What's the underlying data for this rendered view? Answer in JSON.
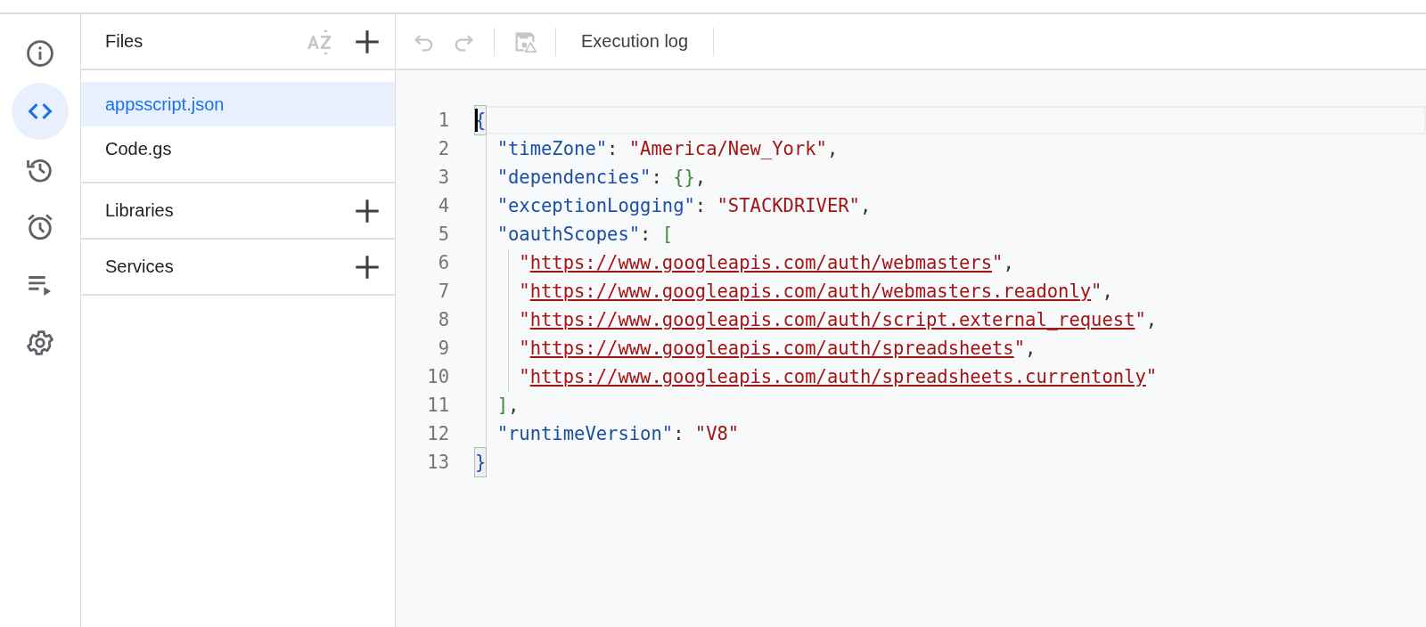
{
  "rail": [
    {
      "kind": "info",
      "selected": false
    },
    {
      "kind": "code",
      "selected": true
    },
    {
      "kind": "history",
      "selected": false
    },
    {
      "kind": "triggers",
      "selected": false
    },
    {
      "kind": "executions",
      "selected": false
    },
    {
      "kind": "settings",
      "selected": false
    }
  ],
  "files": {
    "title": "Files",
    "items": [
      {
        "name": "appsscript.json",
        "selected": true
      },
      {
        "name": "Code.gs",
        "selected": false
      }
    ]
  },
  "sections": [
    {
      "title": "Libraries"
    },
    {
      "title": "Services"
    }
  ],
  "toolbar": {
    "buttons": [
      {
        "kind": "undo",
        "disabled": true
      },
      {
        "kind": "redo",
        "disabled": true
      },
      {
        "kind": "save",
        "disabled": true
      }
    ],
    "execution_log": "Execution log"
  },
  "editor": {
    "lines": [
      {
        "number": "1",
        "current": true,
        "tokens": [
          {
            "kind": "brace",
            "text": "{",
            "matched": true
          }
        ]
      },
      {
        "number": "2",
        "current": false,
        "tokens": [
          {
            "kind": "key",
            "text": "  \"timeZone\""
          },
          {
            "kind": "punct",
            "text": ": "
          },
          {
            "kind": "string",
            "text": "\"America/New_York\""
          },
          {
            "kind": "punct",
            "text": ","
          }
        ]
      },
      {
        "number": "3",
        "current": false,
        "tokens": [
          {
            "kind": "key",
            "text": "  \"dependencies\""
          },
          {
            "kind": "punct",
            "text": ": "
          },
          {
            "kind": "bracket",
            "text": "{}"
          },
          {
            "kind": "punct",
            "text": ","
          }
        ]
      },
      {
        "number": "4",
        "current": false,
        "tokens": [
          {
            "kind": "key",
            "text": "  \"exceptionLogging\""
          },
          {
            "kind": "punct",
            "text": ": "
          },
          {
            "kind": "string",
            "text": "\"STACKDRIVER\""
          },
          {
            "kind": "punct",
            "text": ","
          }
        ]
      },
      {
        "number": "5",
        "current": false,
        "tokens": [
          {
            "kind": "key",
            "text": "  \"oauthScopes\""
          },
          {
            "kind": "punct",
            "text": ": "
          },
          {
            "kind": "bracket",
            "text": "["
          }
        ]
      },
      {
        "number": "6",
        "current": false,
        "tokens": [
          {
            "kind": "string",
            "text": "    \""
          },
          {
            "kind": "url",
            "text": "https://www.googleapis.com/auth/webmasters"
          },
          {
            "kind": "string",
            "text": "\""
          },
          {
            "kind": "punct",
            "text": ","
          }
        ]
      },
      {
        "number": "7",
        "current": false,
        "tokens": [
          {
            "kind": "string",
            "text": "    \""
          },
          {
            "kind": "url",
            "text": "https://www.googleapis.com/auth/webmasters.readonly"
          },
          {
            "kind": "string",
            "text": "\""
          },
          {
            "kind": "punct",
            "text": ","
          }
        ]
      },
      {
        "number": "8",
        "current": false,
        "tokens": [
          {
            "kind": "string",
            "text": "    \""
          },
          {
            "kind": "url",
            "text": "https://www.googleapis.com/auth/script.external_request"
          },
          {
            "kind": "string",
            "text": "\""
          },
          {
            "kind": "punct",
            "text": ","
          }
        ]
      },
      {
        "number": "9",
        "current": false,
        "tokens": [
          {
            "kind": "string",
            "text": "    \""
          },
          {
            "kind": "url",
            "text": "https://www.googleapis.com/auth/spreadsheets"
          },
          {
            "kind": "string",
            "text": "\""
          },
          {
            "kind": "punct",
            "text": ","
          }
        ]
      },
      {
        "number": "10",
        "current": false,
        "tokens": [
          {
            "kind": "string",
            "text": "    \""
          },
          {
            "kind": "url",
            "text": "https://www.googleapis.com/auth/spreadsheets.currentonly"
          },
          {
            "kind": "string",
            "text": "\""
          }
        ]
      },
      {
        "number": "11",
        "current": false,
        "tokens": [
          {
            "kind": "bracket",
            "text": "  ]"
          },
          {
            "kind": "punct",
            "text": ","
          }
        ]
      },
      {
        "number": "12",
        "current": false,
        "tokens": [
          {
            "kind": "key",
            "text": "  \"runtimeVersion\""
          },
          {
            "kind": "punct",
            "text": ": "
          },
          {
            "kind": "string",
            "text": "\"V8\""
          }
        ]
      },
      {
        "number": "13",
        "current": false,
        "tokens": [
          {
            "kind": "brace",
            "text": "}",
            "matched": true
          }
        ]
      }
    ]
  }
}
